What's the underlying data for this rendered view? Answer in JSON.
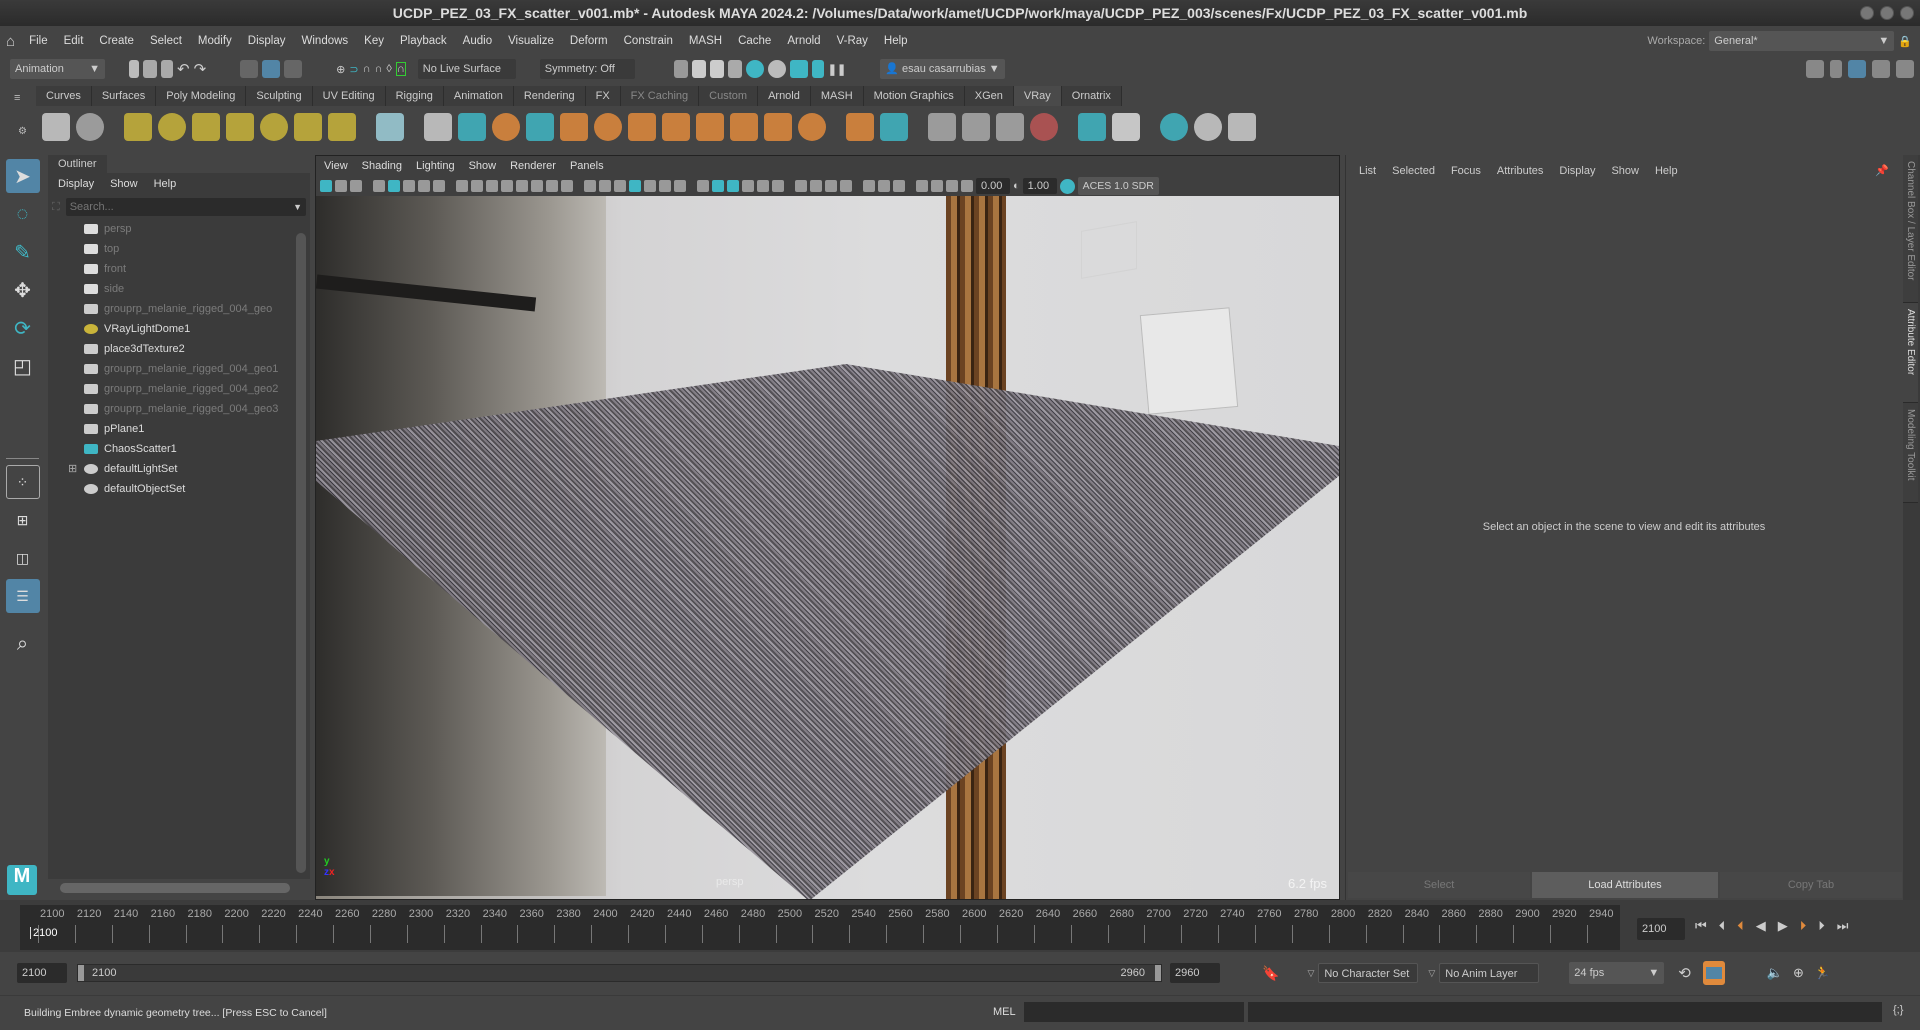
{
  "title": "UCDP_PEZ_03_FX_scatter_v001.mb* - Autodesk MAYA 2024.2: /Volumes/Data/work/amet/UCDP/work/maya/UCDP_PEZ_003/scenes/Fx/UCDP_PEZ_03_FX_scatter_v001.mb",
  "menu": [
    "File",
    "Edit",
    "Create",
    "Select",
    "Modify",
    "Display",
    "Windows",
    "Key",
    "Playback",
    "Audio",
    "Visualize",
    "Deform",
    "Constrain",
    "MASH",
    "Cache",
    "Arnold",
    "V-Ray",
    "Help"
  ],
  "workspace": {
    "label": "Workspace:",
    "value": "General*"
  },
  "statusline": {
    "menu_set": "Animation",
    "live_surface": "No Live Surface",
    "symmetry": "Symmetry: Off",
    "user": "esau casarrubias"
  },
  "shelf_tabs": [
    {
      "label": "Curves"
    },
    {
      "label": "Surfaces"
    },
    {
      "label": "Poly Modeling"
    },
    {
      "label": "Sculpting"
    },
    {
      "label": "UV Editing"
    },
    {
      "label": "Rigging"
    },
    {
      "label": "Animation"
    },
    {
      "label": "Rendering"
    },
    {
      "label": "FX"
    },
    {
      "label": "FX Caching",
      "dim": true
    },
    {
      "label": "Custom",
      "dim": true
    },
    {
      "label": "Arnold"
    },
    {
      "label": "MASH"
    },
    {
      "label": "Motion Graphics"
    },
    {
      "label": "XGen"
    },
    {
      "label": "VRay",
      "active": true
    },
    {
      "label": "Ornatrix"
    }
  ],
  "outliner": {
    "tab": "Outliner",
    "menu": [
      "Display",
      "Show",
      "Help"
    ],
    "search_placeholder": "Search...",
    "items": [
      {
        "label": "persp",
        "icon": "camera-icon",
        "dim": true
      },
      {
        "label": "top",
        "icon": "camera-icon",
        "dim": true
      },
      {
        "label": "front",
        "icon": "camera-icon",
        "dim": true
      },
      {
        "label": "side",
        "icon": "camera-icon",
        "dim": true
      },
      {
        "label": "grouprp_melanie_rigged_004_geo",
        "icon": "transform-icon",
        "dim": true
      },
      {
        "label": "VRayLightDome1",
        "icon": "dome-light-icon"
      },
      {
        "label": "place3dTexture2",
        "icon": "place3d-texture-icon"
      },
      {
        "label": "grouprp_melanie_rigged_004_geo1",
        "icon": "transform-icon",
        "dim": true
      },
      {
        "label": "grouprp_melanie_rigged_004_geo2",
        "icon": "transform-icon",
        "dim": true
      },
      {
        "label": "grouprp_melanie_rigged_004_geo3",
        "icon": "transform-icon",
        "dim": true
      },
      {
        "label": "pPlane1",
        "icon": "transform-icon"
      },
      {
        "label": "ChaosScatter1",
        "icon": "scatter-icon"
      },
      {
        "label": "defaultLightSet",
        "icon": "set-icon",
        "expandable": true
      },
      {
        "label": "defaultObjectSet",
        "icon": "set-icon"
      }
    ]
  },
  "viewport": {
    "menu": [
      "View",
      "Shading",
      "Lighting",
      "Show",
      "Renderer",
      "Panels"
    ],
    "exposure": "0.00",
    "gamma": "1.00",
    "color_space": "ACES 1.0 SDR",
    "camera_label": "persp",
    "fps": "6.2 fps"
  },
  "attribute_editor": {
    "menu": [
      "List",
      "Selected",
      "Focus",
      "Attributes",
      "Display",
      "Show",
      "Help"
    ],
    "message": "Select an object in the scene to view and edit its attributes",
    "buttons": {
      "select": "Select",
      "load": "Load Attributes",
      "copy": "Copy Tab"
    }
  },
  "side_tabs": [
    "Channel Box / Layer Editor",
    "Attribute Editor",
    "Modeling Toolkit"
  ],
  "timeline": {
    "ticks": [
      "2100",
      "2120",
      "2140",
      "2160",
      "2180",
      "2200",
      "2220",
      "2240",
      "2260",
      "2280",
      "2300",
      "2320",
      "2340",
      "2360",
      "2380",
      "2400",
      "2420",
      "2440",
      "2460",
      "2480",
      "2500",
      "2520",
      "2540",
      "2560",
      "2580",
      "2600",
      "2620",
      "2640",
      "2660",
      "2680",
      "2700",
      "2720",
      "2740",
      "2760",
      "2780",
      "2800",
      "2820",
      "2840",
      "2860",
      "2880",
      "2900",
      "2920",
      "2940"
    ],
    "current_frame": "2100",
    "current_field": "2100"
  },
  "range": {
    "start": "2100",
    "range_start": "2100",
    "range_end": "2960",
    "end": "2960",
    "character_set": "No Character Set",
    "anim_layer": "No Anim Layer",
    "fps": "24 fps"
  },
  "command": {
    "status": "Building Embree dynamic geometry tree... [Press ESC to Cancel]",
    "lang": "MEL"
  },
  "colors": {
    "accent": "#5285a6",
    "teal": "#3fb6c4",
    "orange": "#e08a3c",
    "yellow": "#c9b43a"
  }
}
